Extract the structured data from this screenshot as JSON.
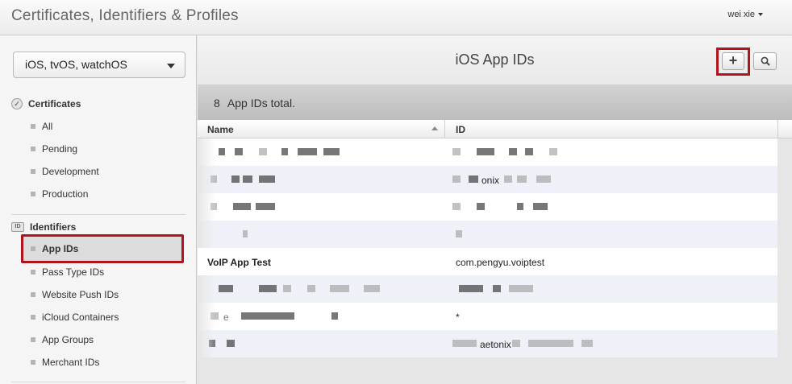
{
  "header": {
    "title": "Certificates, Identifiers & Profiles",
    "user": "wei xie"
  },
  "sidebar": {
    "platform": "iOS, tvOS, watchOS",
    "certificates": {
      "heading": "Certificates",
      "items": [
        "All",
        "Pending",
        "Development",
        "Production"
      ]
    },
    "identifiers": {
      "heading": "Identifiers",
      "icon_text": "ID",
      "items": [
        "App IDs",
        "Pass Type IDs",
        "Website Push IDs",
        "iCloud Containers",
        "App Groups",
        "Merchant IDs"
      ],
      "active": "App IDs"
    }
  },
  "main": {
    "title": "iOS App IDs",
    "add_label": "+",
    "total_count": "8",
    "total_label": "App IDs total.",
    "columns": {
      "name": "Name",
      "id": "ID"
    },
    "rows": [
      {
        "name": "",
        "id": "",
        "redacted": true
      },
      {
        "name": "",
        "id": "onix",
        "redacted": true
      },
      {
        "name": "",
        "id": "",
        "redacted": true
      },
      {
        "name": "",
        "id": "",
        "redacted": true
      },
      {
        "name": "VoIP App Test",
        "id": "com.pengyu.voiptest",
        "redacted": false
      },
      {
        "name": "",
        "id": "",
        "redacted": true
      },
      {
        "name": "e",
        "id": "*",
        "redacted": true
      },
      {
        "name": "",
        "id": "aetonix",
        "redacted": true
      }
    ]
  },
  "colors": {
    "highlight_border": "#b0151b",
    "row_alt": "#eef2f8"
  }
}
